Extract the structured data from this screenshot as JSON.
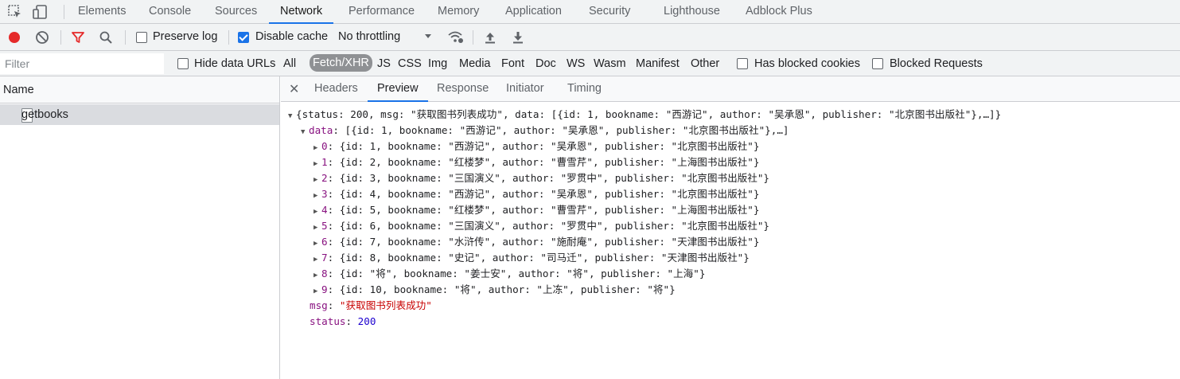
{
  "tabs": [
    "Elements",
    "Console",
    "Sources",
    "Network",
    "Performance",
    "Memory",
    "Application",
    "Security",
    "Lighthouse",
    "Adblock Plus"
  ],
  "active_tab": "Network",
  "toolbar": {
    "preserve_log": "Preserve log",
    "disable_cache": "Disable cache",
    "throttling": "No throttling",
    "preserve_log_checked": false,
    "disable_cache_checked": true
  },
  "filter": {
    "placeholder": "Filter",
    "hide_data_urls": "Hide data URLs",
    "types": [
      "All",
      "Fetch/XHR",
      "JS",
      "CSS",
      "Img",
      "Media",
      "Font",
      "Doc",
      "WS",
      "Wasm",
      "Manifest",
      "Other"
    ],
    "active_type": "Fetch/XHR",
    "blocked_cookies": "Has blocked cookies",
    "blocked_requests": "Blocked Requests"
  },
  "requests": {
    "header": "Name",
    "items": [
      "getbooks"
    ]
  },
  "detail_tabs": [
    "Headers",
    "Preview",
    "Response",
    "Initiator",
    "Timing"
  ],
  "active_detail_tab": "Preview",
  "preview": {
    "root_summary": "{status: 200, msg: \"获取图书列表成功\", data: [{id: 1, bookname: \"西游记\", author: \"吴承恩\", publisher: \"北京图书出版社\"},…]}",
    "data_summary": "[{id: 1, bookname: \"西游记\", author: \"吴承恩\", publisher: \"北京图书出版社\"},…]",
    "items": [
      {
        "index": "0",
        "text": "{id: 1, bookname: \"西游记\", author: \"吴承恩\", publisher: \"北京图书出版社\"}"
      },
      {
        "index": "1",
        "text": "{id: 2, bookname: \"红楼梦\", author: \"曹雪芹\", publisher: \"上海图书出版社\"}"
      },
      {
        "index": "2",
        "text": "{id: 3, bookname: \"三国演义\", author: \"罗贯中\", publisher: \"北京图书出版社\"}"
      },
      {
        "index": "3",
        "text": "{id: 4, bookname: \"西游记\", author: \"吴承恩\", publisher: \"北京图书出版社\"}"
      },
      {
        "index": "4",
        "text": "{id: 5, bookname: \"红楼梦\", author: \"曹雪芹\", publisher: \"上海图书出版社\"}"
      },
      {
        "index": "5",
        "text": "{id: 6, bookname: \"三国演义\", author: \"罗贯中\", publisher: \"北京图书出版社\"}"
      },
      {
        "index": "6",
        "text": "{id: 7, bookname: \"水浒传\", author: \"施耐庵\", publisher: \"天津图书出版社\"}"
      },
      {
        "index": "7",
        "text": "{id: 8, bookname: \"史记\", author: \"司马迁\", publisher: \"天津图书出版社\"}"
      },
      {
        "index": "8",
        "text": "{id: \"将\", bookname: \"姜士安\", author: \"将\", publisher: \"上海\"}"
      },
      {
        "index": "9",
        "text": "{id: 10, bookname: \"将\", author: \"上冻\", publisher: \"将\"}"
      }
    ],
    "msg_key": "msg",
    "msg_value": "\"获取图书列表成功\"",
    "status_key": "status",
    "status_value": "200",
    "data_key": "data"
  },
  "colors": {
    "accent": "#1a73e8",
    "record": "#e52a2a",
    "filter_icon": "#e52a2a",
    "json_key": "#881280",
    "json_string": "#c80000",
    "json_number": "#1c00cf"
  }
}
